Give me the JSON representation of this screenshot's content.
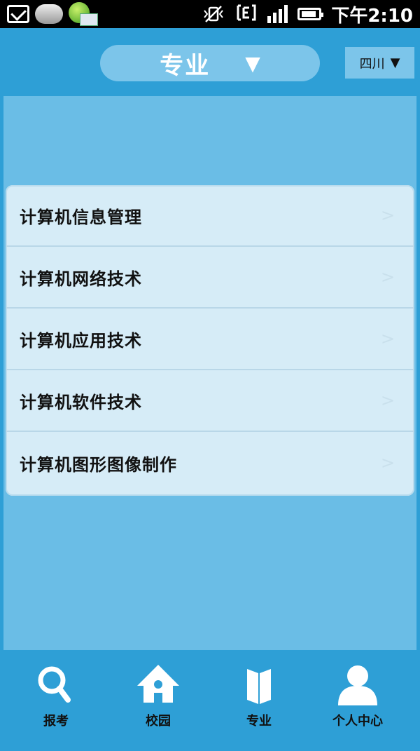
{
  "status_bar": {
    "time": "下午2:10",
    "icons": [
      "mail-icon",
      "cloud-icon",
      "app-notification-icon",
      "vibrate-off-icon",
      "data-icon",
      "signal-icon",
      "battery-icon"
    ]
  },
  "header": {
    "title": "专业",
    "title_arrow": "▼",
    "region": "四川",
    "region_arrow": "▼"
  },
  "majors": [
    {
      "label": "计算机信息管理"
    },
    {
      "label": "计算机网络技术"
    },
    {
      "label": "计算机应用技术"
    },
    {
      "label": "计算机软件技术"
    },
    {
      "label": "计算机图形图像制作"
    }
  ],
  "tabs": [
    {
      "label": "报考",
      "icon": "search-icon"
    },
    {
      "label": "校园",
      "icon": "house-icon"
    },
    {
      "label": "专业",
      "icon": "book-icon"
    },
    {
      "label": "个人中心",
      "icon": "person-icon"
    }
  ],
  "colors": {
    "background": "#2e9fd6",
    "panel": "#6abde6",
    "pill": "#7cc5ea",
    "list": "#d6ecf7"
  }
}
